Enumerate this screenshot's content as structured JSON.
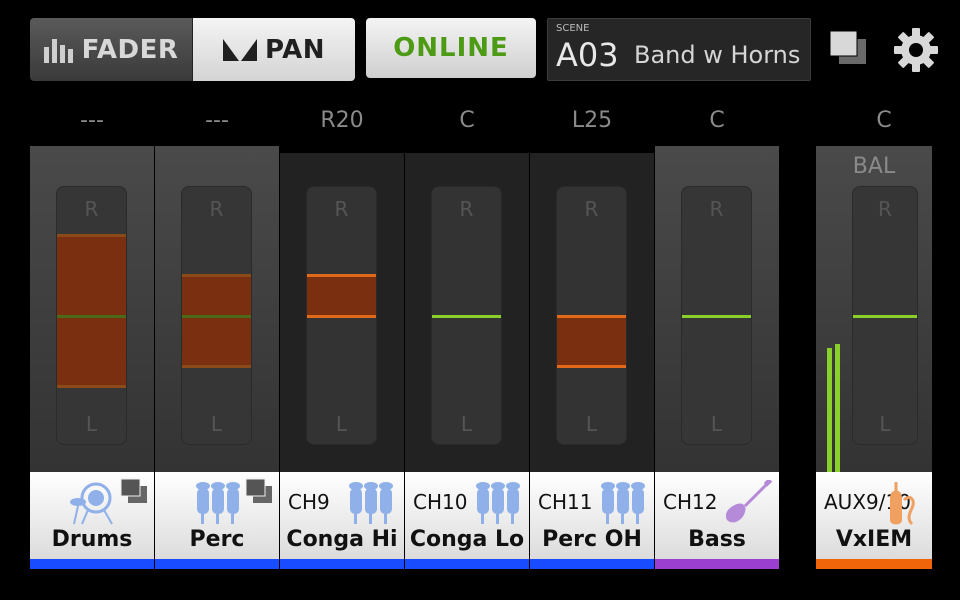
{
  "topbar": {
    "fader_label": "FADER",
    "pan_label": "PAN",
    "online_label": "ONLINE",
    "scene_caption": "SCENE",
    "scene_number": "A03",
    "scene_name": "Band w Horns"
  },
  "channels": [
    {
      "pan": "---",
      "id": "",
      "name": "Drums",
      "icon": "drum-kit-icon",
      "color": "#1a4cff",
      "band_top": 0.19,
      "band_bottom": 0.78,
      "linked": true
    },
    {
      "pan": "---",
      "id": "",
      "name": "Perc",
      "icon": "bongo-icon",
      "color": "#1a4cff",
      "band_top": 0.34,
      "band_bottom": 0.7,
      "linked": true
    },
    {
      "pan": "R20",
      "id": "CH9",
      "name": "Conga Hi",
      "icon": "bongo-icon",
      "color": "#1a4cff"
    },
    {
      "pan": "C",
      "id": "CH10",
      "name": "Conga Lo",
      "icon": "bongo-icon",
      "color": "#1a4cff"
    },
    {
      "pan": "L25",
      "id": "CH11",
      "name": "Perc OH",
      "icon": "bongo-icon",
      "color": "#1a4cff"
    },
    {
      "pan": "C",
      "id": "CH12",
      "name": "Bass",
      "icon": "bass-guitar-icon",
      "color": "#9a3fd0"
    }
  ],
  "aux": {
    "pan": "C",
    "bal_label": "BAL",
    "id": "AUX9/10",
    "name": "VxIEM",
    "icon": "in-ear-monitor-icon",
    "color": "#f0640a"
  },
  "track_labels": {
    "right": "R",
    "left": "L"
  },
  "colors": {
    "accent_online": "#4d9a14",
    "pan_band": "#7a3010",
    "pan_line": "#e06a1a",
    "center_line": "#8ad02a"
  }
}
